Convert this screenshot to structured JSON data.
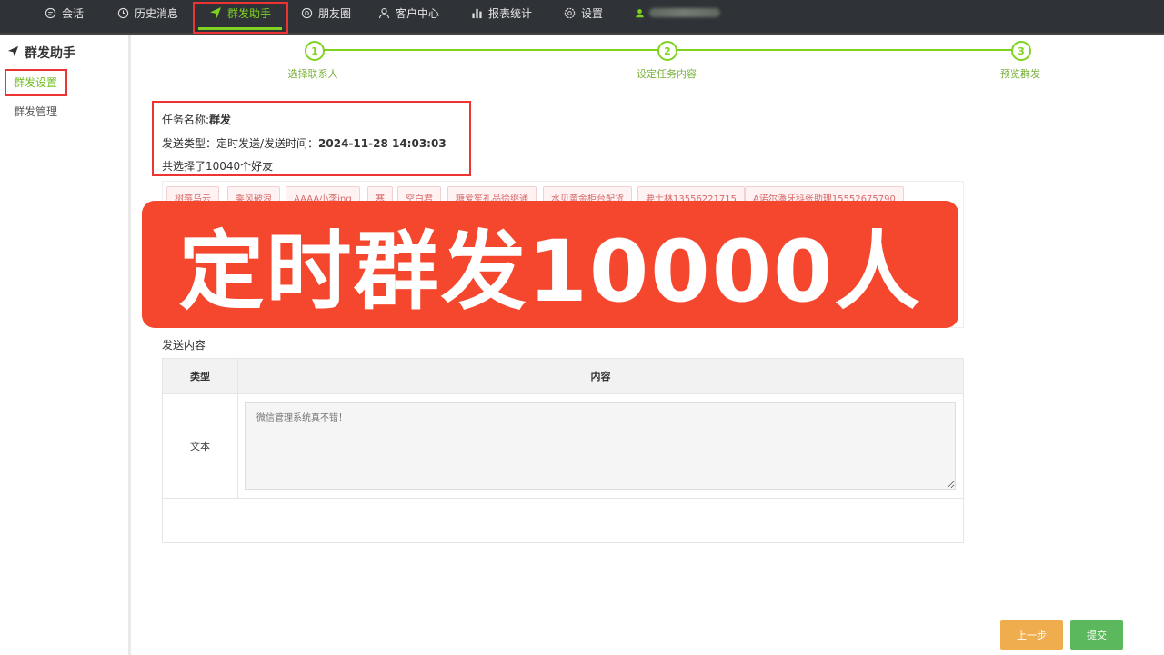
{
  "nav": {
    "items": [
      {
        "label": "会话",
        "icon": "chat-icon"
      },
      {
        "label": "历史消息",
        "icon": "clock-icon"
      },
      {
        "label": "群发助手",
        "icon": "paper-plane-icon"
      },
      {
        "label": "朋友圈",
        "icon": "aperture-icon"
      },
      {
        "label": "客户中心",
        "icon": "user-icon"
      },
      {
        "label": "报表统计",
        "icon": "bar-chart-icon"
      },
      {
        "label": "设置",
        "icon": "gear-icon"
      }
    ],
    "accent_color": "#7ed321"
  },
  "sidebar": {
    "title": "群发助手",
    "items": [
      {
        "label": "群发设置",
        "active": true
      },
      {
        "label": "群发管理",
        "active": false
      }
    ]
  },
  "steps": [
    {
      "num": "1",
      "label": "选择联系人"
    },
    {
      "num": "2",
      "label": "设定任务内容"
    },
    {
      "num": "3",
      "label": "预览群发"
    }
  ],
  "task": {
    "name_label": "任务名称:",
    "name_value": "群发",
    "type_label": "发送类型：定时发送/发送时间：",
    "send_time": "2024-11-28 14:03:03",
    "selected_text": "共选择了10040个好友"
  },
  "friends": {
    "tags": [
      "树莓乌云",
      "乘风破浪",
      "AAAA小李ing",
      "寒",
      "空白君",
      "糖爱笙礼品徐继通",
      "水贝黄金柜台配货",
      "要士林13556221715",
      "A诺尔潘牙科张助理15552675790"
    ]
  },
  "banner": {
    "text": "定时群发10000人",
    "color": "#f5472e"
  },
  "content": {
    "section_title": "发送内容",
    "col_type": "类型",
    "col_content": "内容",
    "row_type": "文本",
    "placeholder": "微信管理系统真不错！"
  },
  "buttons": {
    "prev": "上一步",
    "submit": "提交"
  }
}
